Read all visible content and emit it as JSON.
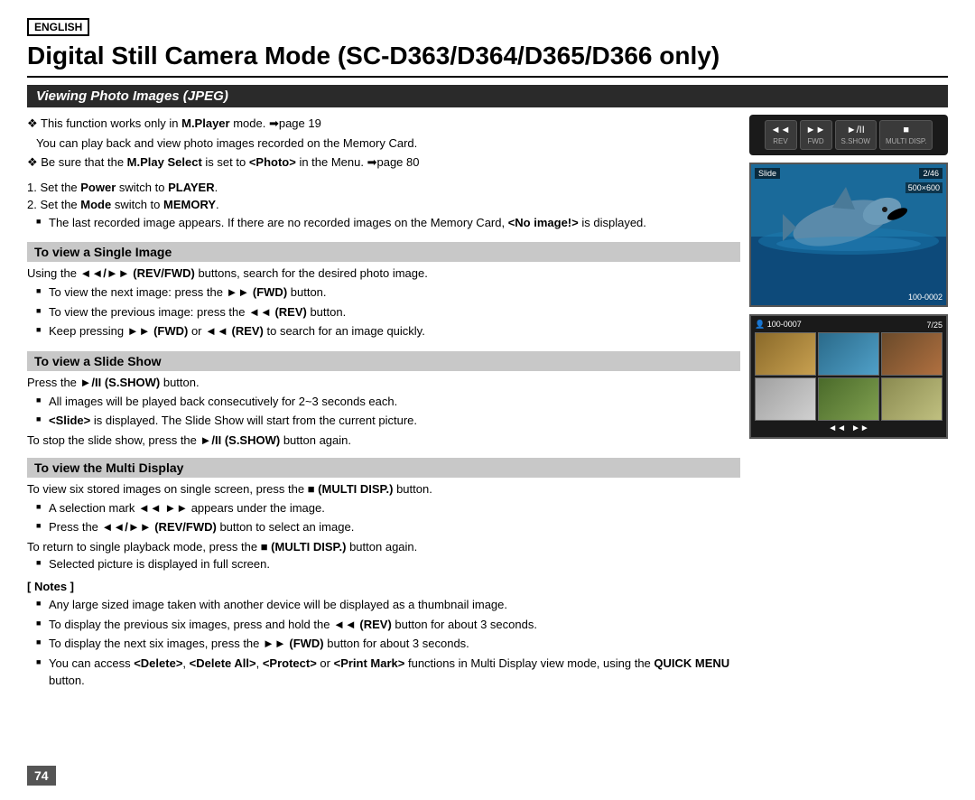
{
  "lang_badge": "ENGLISH",
  "main_title": "Digital Still Camera Mode (SC-D363/D364/D365/D366 only)",
  "section_header": "Viewing Photo Images (JPEG)",
  "intro": {
    "line1": "❖ This function works only in M.Player mode. ➡page 19",
    "line1a": "You can play back and view photo images recorded on the Memory Card.",
    "line2": "❖ Be sure that the M.Play Select is set to <Photo> in the Menu. ➡page 80",
    "step1": "1. Set the Power switch to PLAYER.",
    "step2": "2. Set the Mode switch to MEMORY.",
    "step3_bullet": "The last recorded image appears. If there are no recorded images on the Memory Card, <No image!> is displayed."
  },
  "subsections": {
    "single_image": {
      "title": "To view a Single Image",
      "intro": "Using the ◄◄/►► (REV/FWD) buttons, search for the desired photo image.",
      "bullets": [
        "To view the next image: press the ►► (FWD) button.",
        "To view the previous image: press the ◄◄ (REV) button.",
        "Keep pressing ►► (FWD) or ◄◄ (REV) to search for an image quickly."
      ]
    },
    "slide_show": {
      "title": "To view a Slide Show",
      "intro": "Press the ►/II (S.SHOW) button.",
      "bullets": [
        "All images will be played back consecutively for 2~3 seconds each.",
        "<Slide> is displayed. The Slide Show will start from the current picture."
      ],
      "outro": "To stop the slide show, press the ►/II (S.SHOW) button again."
    },
    "multi_display": {
      "title": "To view the Multi Display",
      "intro": "To view six stored images on single screen, press the ■ (MULTI DISP.) button.",
      "bullets": [
        "A selection mark ◄◄ ►► appears under the image.",
        "Press the ◄◄/►► (REV/FWD) button to select an image."
      ],
      "outro": "To return to single playback mode, press the ■ (MULTI DISP.) button again.",
      "outro_bullet": "Selected picture is displayed in full screen."
    }
  },
  "notes": {
    "title": "[ Notes ]",
    "bullets": [
      "Any large sized image taken with another device will be displayed as a thumbnail image.",
      "To display the previous six images, press and hold the ◄◄ (REV) button for about 3 seconds.",
      "To display the next six images, press the ►► (FWD) button for about 3 seconds.",
      "You can access <Delete>, <Delete All>, <Protect> or <Print Mark> functions in Multi Display view mode, using the QUICK MENU button."
    ]
  },
  "remote": {
    "buttons": [
      {
        "icon": "◄◄",
        "label": "REV"
      },
      {
        "icon": "►►",
        "label": "FWD"
      },
      {
        "icon": "►/II",
        "label": "S.SHOW"
      },
      {
        "icon": "■",
        "label": "MULTI DISP."
      }
    ]
  },
  "single_img": {
    "slide_label": "Slide",
    "counter": "2/46",
    "resolution": "500×600",
    "filename": "100-0002"
  },
  "multi_img": {
    "icon_label": "👤 100-0007",
    "counter": "7/25"
  },
  "page_number": "74"
}
